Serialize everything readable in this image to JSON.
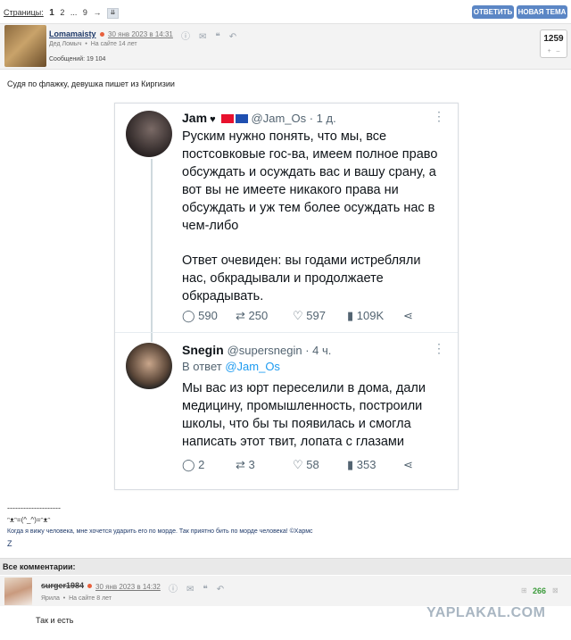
{
  "topbar": {
    "pages_label": "Страницы:",
    "current_page": "1",
    "page2": "2",
    "ellipsis": "...",
    "page9": "9",
    "next_arrow": "→",
    "jump_icon": "⇊",
    "reply_button": "ОТВЕТИТЬ",
    "new_topic_button": "НОВАЯ ТЕМА"
  },
  "post": {
    "username": "Lomamaisty",
    "date": "30 янв 2023 в 14:31",
    "user_title": "Дед Ломыч",
    "online": "На сайте 14 лет",
    "messages": "Сообщений: 19 104",
    "rating": "1259",
    "rating_plus": "+",
    "rating_minus": "–",
    "text": "Судя по флажку, девушка пишет из Киргизии"
  },
  "tweet1": {
    "name": "Jam",
    "handle": "@Jam_Os · 1 д.",
    "lines": [
      "Руским нужно понять, что мы, все",
      "постсовковые гос-ва, имеем полное право",
      "обсуждать и осуждать вас и вашу срану, а",
      "вот вы не имеете никакого права ни",
      "обсуждать и уж тем более осуждать нас в",
      "чем-либо",
      "",
      "Ответ очевиден: вы годами истребляли",
      "нас, обкрадывали и продолжаете",
      "обкрадывать."
    ],
    "replies": "590",
    "retweets": "250",
    "likes": "597",
    "views": "109K"
  },
  "tweet2": {
    "name": "Snegin",
    "handle": "@supersnegin · 4 ч.",
    "reply_prefix": "В ответ",
    "reply_to": "@Jam_Os",
    "lines": [
      "Мы вас из юрт переселили в дома, дали",
      "медицину, промышленность, построили",
      "школы, что бы ты появилась и смогла",
      "написать этот твит, лопата с глазами"
    ],
    "replies": "2",
    "retweets": "3",
    "likes": "58",
    "views": "353"
  },
  "signature": {
    "line": "--------------------",
    "art": "ᵔᴥᵔ=(^_^)=ᵔᴥᵔ",
    "quote": "Когда я вижу человека, мне хочется ударить его по морде. Так приятно бить по морде человека! ©Хармс",
    "z": "Z"
  },
  "comments": {
    "header": "Все комментарии:",
    "items": [
      {
        "username": "surger1984",
        "date": "30 янв 2023 в 14:32",
        "title": "Ярила",
        "online": "На сайте 8 лет",
        "rating": "266",
        "text": "Так и есть"
      }
    ]
  },
  "watermark": "YAPLAKAL.COM"
}
